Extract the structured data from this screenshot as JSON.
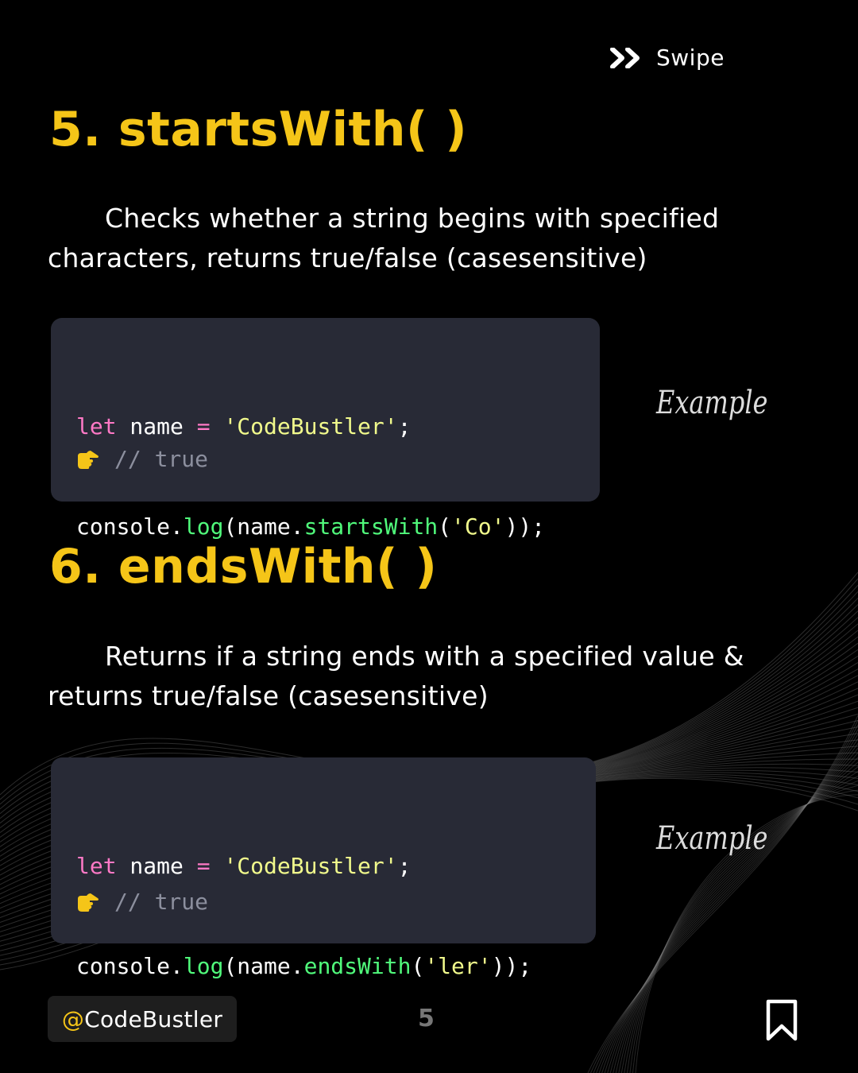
{
  "header": {
    "swipe_label": "Swipe",
    "swipe_icon": "double-chevron-right-icon"
  },
  "sections": [
    {
      "title": "5. startsWith( )",
      "description": "Checks whether a string begins with specified characters, returns true/false (casesensitive)",
      "code": {
        "line1": {
          "kw": "let",
          "ident": " name ",
          "op": "=",
          "space": " ",
          "str": "'CodeBustler'",
          "end": ";"
        },
        "line2": {
          "obj": "console.",
          "fn": "log",
          "open": "(name.",
          "method": "startsWith",
          "arg_open": "(",
          "arg": "'Co'",
          "close": "));"
        },
        "result": "// true"
      },
      "side_label": "Example"
    },
    {
      "title": "6. endsWith( )",
      "description": "Returns if a string ends with a specified value & returns true/false (casesensitive)",
      "code": {
        "line1": {
          "kw": "let",
          "ident": " name ",
          "op": "=",
          "space": " ",
          "str": "'CodeBustler'",
          "end": ";"
        },
        "line2": {
          "obj": "console.",
          "fn": "log",
          "open": "(name.",
          "method": "endsWith",
          "arg_open": "(",
          "arg": "'ler'",
          "close": "));"
        },
        "result": "// true"
      },
      "side_label": "Example"
    }
  ],
  "footer": {
    "handle_at": "@",
    "handle_name": "CodeBustler",
    "page_number": "5",
    "bookmark_icon": "bookmark-icon"
  },
  "colors": {
    "accent": "#f5c518",
    "background": "#000000",
    "code_bg": "#282a36"
  }
}
